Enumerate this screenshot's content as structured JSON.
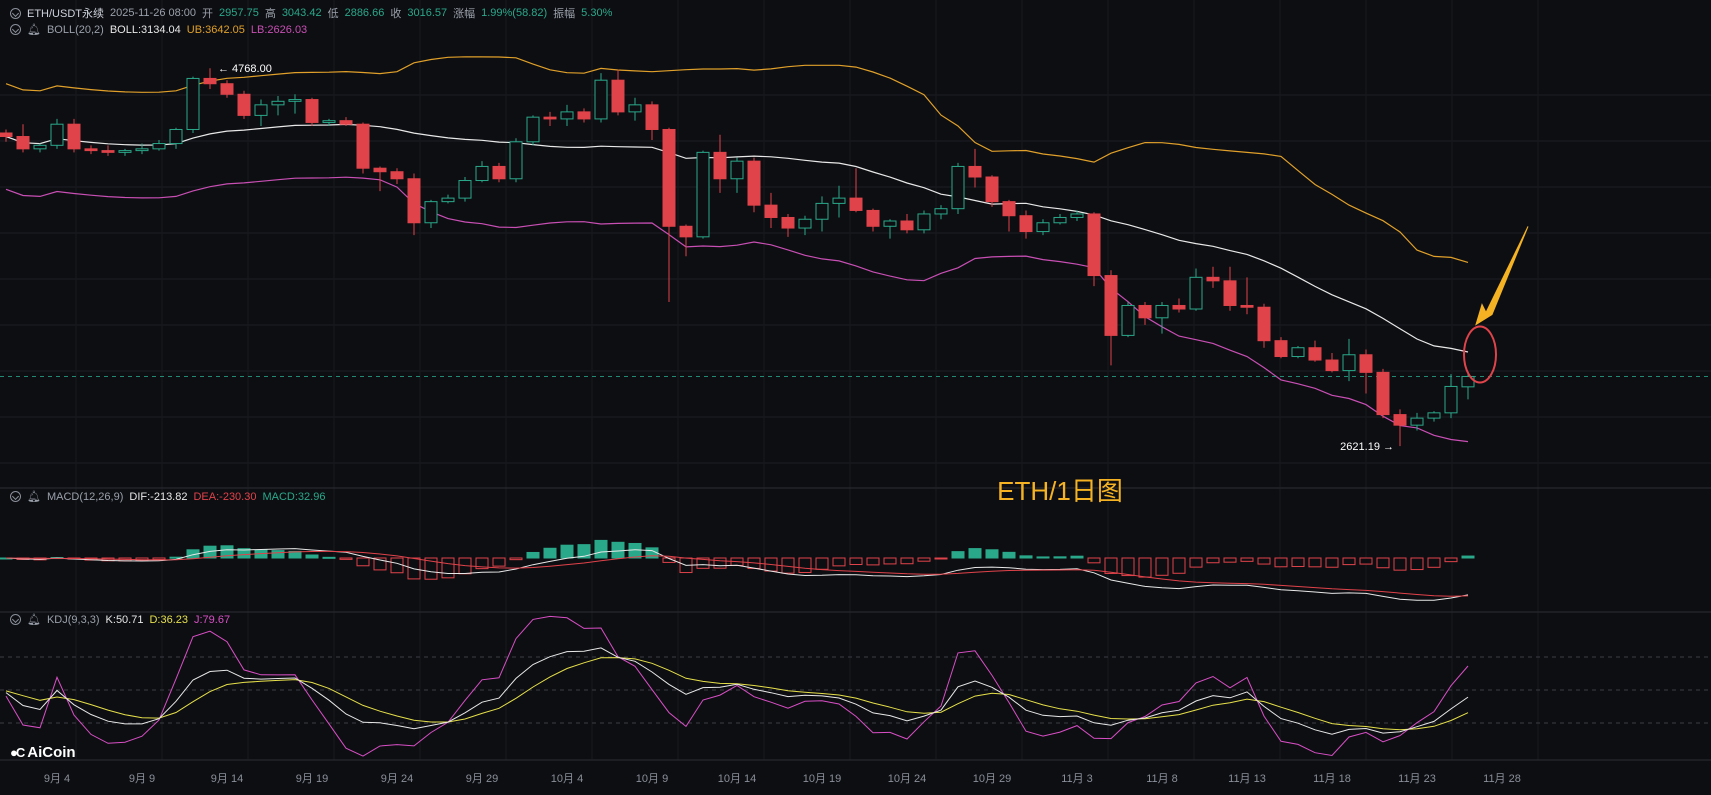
{
  "header": {
    "symbol": "ETH/USDT永续",
    "datetime": "2025-11-26 08:00",
    "open_label": "开",
    "open": "2957.75",
    "high_label": "高",
    "high": "3043.42",
    "low_label": "低",
    "low": "2886.66",
    "close_label": "收",
    "close": "3016.57",
    "change_label": "涨幅",
    "change": "1.99%(58.82)",
    "amp_label": "振幅",
    "amp": "5.30%"
  },
  "boll": {
    "label": "BOLL(20,2)",
    "mid": "BOLL:3134.04",
    "ub": "UB:3642.05",
    "lb": "LB:2626.03"
  },
  "macd": {
    "label": "MACD(12,26,9)",
    "dif": "DIF:-213.82",
    "dea": "DEA:-230.30",
    "macd": "MACD:32.96"
  },
  "kdj": {
    "label": "KDJ(9,3,3)",
    "k": "K:50.71",
    "d": "D:36.23",
    "j": "J:79.67"
  },
  "annotations": {
    "high_marker": "← 4768.00",
    "low_marker": "2621.19 →",
    "title": "ETH/1日图"
  },
  "logo": {
    "text": "AiCoin"
  },
  "colors": {
    "up": "#2aa88a",
    "down": "#e0434a",
    "mid": "#e8e8e8",
    "ub": "#e0a02a",
    "lb": "#c84fb4",
    "dea": "#e0434a",
    "k": "#e8e8e8",
    "d": "#e6e04a",
    "j": "#d94fc6",
    "accent": "#f5b324"
  },
  "chart_data": {
    "type": "candlestick",
    "x_ticks": [
      "9月 4",
      "9月 9",
      "9月 14",
      "9月 19",
      "9月 24",
      "9月 29",
      "10月 4",
      "10月 9",
      "10月 14",
      "10月 19",
      "10月 24",
      "10月 29",
      "11月 3",
      "11月 8",
      "11月 13",
      "11月 18",
      "11月 23",
      "11月 28"
    ],
    "dates": [
      "9/1",
      "9/2",
      "9/3",
      "9/4",
      "9/5",
      "9/6",
      "9/7",
      "9/8",
      "9/9",
      "9/10",
      "9/11",
      "9/12",
      "9/13",
      "9/14",
      "9/15",
      "9/16",
      "9/17",
      "9/18",
      "9/19",
      "9/20",
      "9/21",
      "9/22",
      "9/23",
      "9/24",
      "9/25",
      "9/26",
      "9/27",
      "9/28",
      "9/29",
      "9/30",
      "10/1",
      "10/2",
      "10/3",
      "10/4",
      "10/5",
      "10/6",
      "10/7",
      "10/8",
      "10/9",
      "10/10",
      "10/11",
      "10/12",
      "10/13",
      "10/14",
      "10/15",
      "10/16",
      "10/17",
      "10/18",
      "10/19",
      "10/20",
      "10/21",
      "10/22",
      "10/23",
      "10/24",
      "10/25",
      "10/26",
      "10/27",
      "10/28",
      "10/29",
      "10/30",
      "10/31",
      "11/1",
      "11/2",
      "11/3",
      "11/4",
      "11/5",
      "11/6",
      "11/7",
      "11/8",
      "11/9",
      "11/10",
      "11/11",
      "11/12",
      "11/13",
      "11/14",
      "11/15",
      "11/16",
      "11/17",
      "11/18",
      "11/19",
      "11/20",
      "11/21",
      "11/22",
      "11/23",
      "11/24",
      "11/25",
      "11/26"
    ],
    "ohlc": [
      [
        4400,
        4420,
        4350,
        4380
      ],
      [
        4380,
        4450,
        4290,
        4310
      ],
      [
        4310,
        4340,
        4290,
        4330
      ],
      [
        4330,
        4480,
        4310,
        4450
      ],
      [
        4450,
        4480,
        4290,
        4310
      ],
      [
        4310,
        4330,
        4280,
        4300
      ],
      [
        4300,
        4330,
        4270,
        4290
      ],
      [
        4290,
        4310,
        4270,
        4300
      ],
      [
        4300,
        4340,
        4280,
        4310
      ],
      [
        4310,
        4360,
        4300,
        4340
      ],
      [
        4340,
        4430,
        4310,
        4420
      ],
      [
        4420,
        4720,
        4400,
        4710
      ],
      [
        4710,
        4768,
        4650,
        4680
      ],
      [
        4680,
        4700,
        4600,
        4620
      ],
      [
        4620,
        4640,
        4480,
        4500
      ],
      [
        4500,
        4590,
        4440,
        4560
      ],
      [
        4560,
        4610,
        4500,
        4580
      ],
      [
        4580,
        4620,
        4510,
        4590
      ],
      [
        4590,
        4600,
        4440,
        4460
      ],
      [
        4460,
        4480,
        4440,
        4470
      ],
      [
        4470,
        4490,
        4440,
        4450
      ],
      [
        4450,
        4460,
        4170,
        4200
      ],
      [
        4200,
        4210,
        4070,
        4180
      ],
      [
        4180,
        4200,
        4110,
        4140
      ],
      [
        4140,
        4170,
        3820,
        3890
      ],
      [
        3890,
        4020,
        3860,
        4010
      ],
      [
        4010,
        4050,
        4000,
        4030
      ],
      [
        4030,
        4150,
        4010,
        4130
      ],
      [
        4130,
        4240,
        4120,
        4210
      ],
      [
        4210,
        4230,
        4120,
        4140
      ],
      [
        4140,
        4370,
        4120,
        4350
      ],
      [
        4350,
        4500,
        4330,
        4490
      ],
      [
        4490,
        4520,
        4440,
        4480
      ],
      [
        4480,
        4560,
        4440,
        4520
      ],
      [
        4520,
        4540,
        4460,
        4480
      ],
      [
        4480,
        4740,
        4460,
        4700
      ],
      [
        4700,
        4760,
        4500,
        4520
      ],
      [
        4520,
        4600,
        4470,
        4560
      ],
      [
        4560,
        4580,
        4360,
        4420
      ],
      [
        4420,
        4430,
        3440,
        3870
      ],
      [
        3870,
        3880,
        3700,
        3810
      ],
      [
        3810,
        4300,
        3800,
        4290
      ],
      [
        4290,
        4390,
        4060,
        4140
      ],
      [
        4140,
        4260,
        4060,
        4240
      ],
      [
        4240,
        4260,
        3950,
        3990
      ],
      [
        3990,
        4060,
        3860,
        3920
      ],
      [
        3920,
        3940,
        3810,
        3860
      ],
      [
        3860,
        3930,
        3820,
        3910
      ],
      [
        3910,
        4040,
        3840,
        4000
      ],
      [
        4000,
        4100,
        3920,
        4030
      ],
      [
        4030,
        4200,
        3950,
        3960
      ],
      [
        3960,
        3970,
        3840,
        3870
      ],
      [
        3870,
        3910,
        3800,
        3900
      ],
      [
        3900,
        3940,
        3830,
        3850
      ],
      [
        3850,
        3960,
        3830,
        3940
      ],
      [
        3940,
        3990,
        3910,
        3970
      ],
      [
        3970,
        4230,
        3940,
        4210
      ],
      [
        4210,
        4310,
        4090,
        4150
      ],
      [
        4150,
        4160,
        3980,
        4010
      ],
      [
        4010,
        4020,
        3840,
        3930
      ],
      [
        3930,
        3960,
        3800,
        3840
      ],
      [
        3840,
        3910,
        3820,
        3890
      ],
      [
        3890,
        3940,
        3880,
        3920
      ],
      [
        3920,
        3960,
        3900,
        3940
      ],
      [
        3940,
        3950,
        3530,
        3590
      ],
      [
        3590,
        3620,
        3080,
        3250
      ],
      [
        3250,
        3440,
        3240,
        3420
      ],
      [
        3420,
        3440,
        3310,
        3350
      ],
      [
        3350,
        3440,
        3260,
        3420
      ],
      [
        3420,
        3460,
        3380,
        3400
      ],
      [
        3400,
        3630,
        3390,
        3580
      ],
      [
        3580,
        3640,
        3520,
        3560
      ],
      [
        3560,
        3640,
        3390,
        3420
      ],
      [
        3420,
        3580,
        3370,
        3410
      ],
      [
        3410,
        3430,
        3180,
        3220
      ],
      [
        3220,
        3240,
        3120,
        3130
      ],
      [
        3130,
        3190,
        3120,
        3180
      ],
      [
        3180,
        3220,
        3100,
        3110
      ],
      [
        3110,
        3150,
        3040,
        3050
      ],
      [
        3050,
        3230,
        2990,
        3140
      ],
      [
        3140,
        3170,
        2920,
        3040
      ],
      [
        3040,
        3060,
        2780,
        2800
      ],
      [
        2800,
        2830,
        2621.19,
        2740
      ],
      [
        2740,
        2810,
        2710,
        2780
      ],
      [
        2780,
        2820,
        2760,
        2810
      ],
      [
        2810,
        3030,
        2780,
        2960
      ],
      [
        2957.75,
        3043.42,
        2886.66,
        3016.57
      ]
    ],
    "price_range": [
      2400,
      4900
    ],
    "boll_last": {
      "mid": 3134.04,
      "ub": 3642.05,
      "lb": 2626.03
    },
    "macd_last": {
      "dif": -213.82,
      "dea": -230.3,
      "macd": 32.96
    },
    "kdj_last": {
      "k": 50.71,
      "d": 36.23,
      "j": 79.67
    }
  }
}
